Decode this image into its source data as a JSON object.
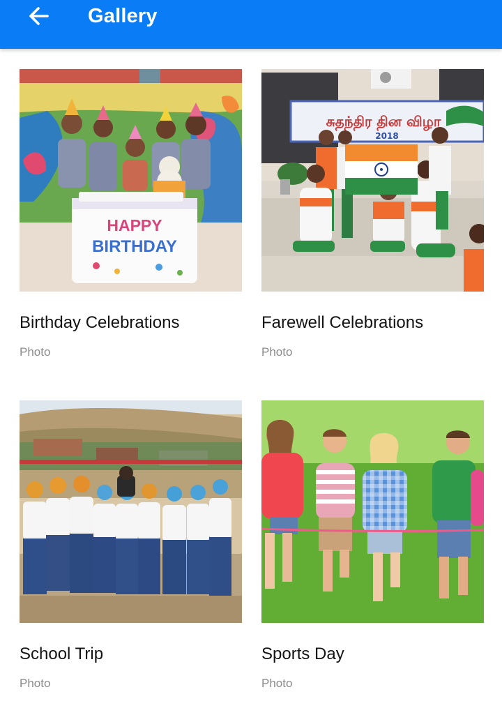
{
  "appbar": {
    "title": "Gallery",
    "back_icon": "arrow-back-icon",
    "color": "#0a7cf6"
  },
  "gallery": {
    "items": [
      {
        "title": "Birthday Celebrations",
        "type": "Photo",
        "banner_text": "HAPPY BIRTHDAY"
      },
      {
        "title": "Farewell Celebrations",
        "type": "Photo",
        "banner_text": "சுதந்திர தின விழா",
        "banner_year": "2018"
      },
      {
        "title": "School Trip",
        "type": "Photo"
      },
      {
        "title": "Sports Day",
        "type": "Photo"
      }
    ]
  }
}
